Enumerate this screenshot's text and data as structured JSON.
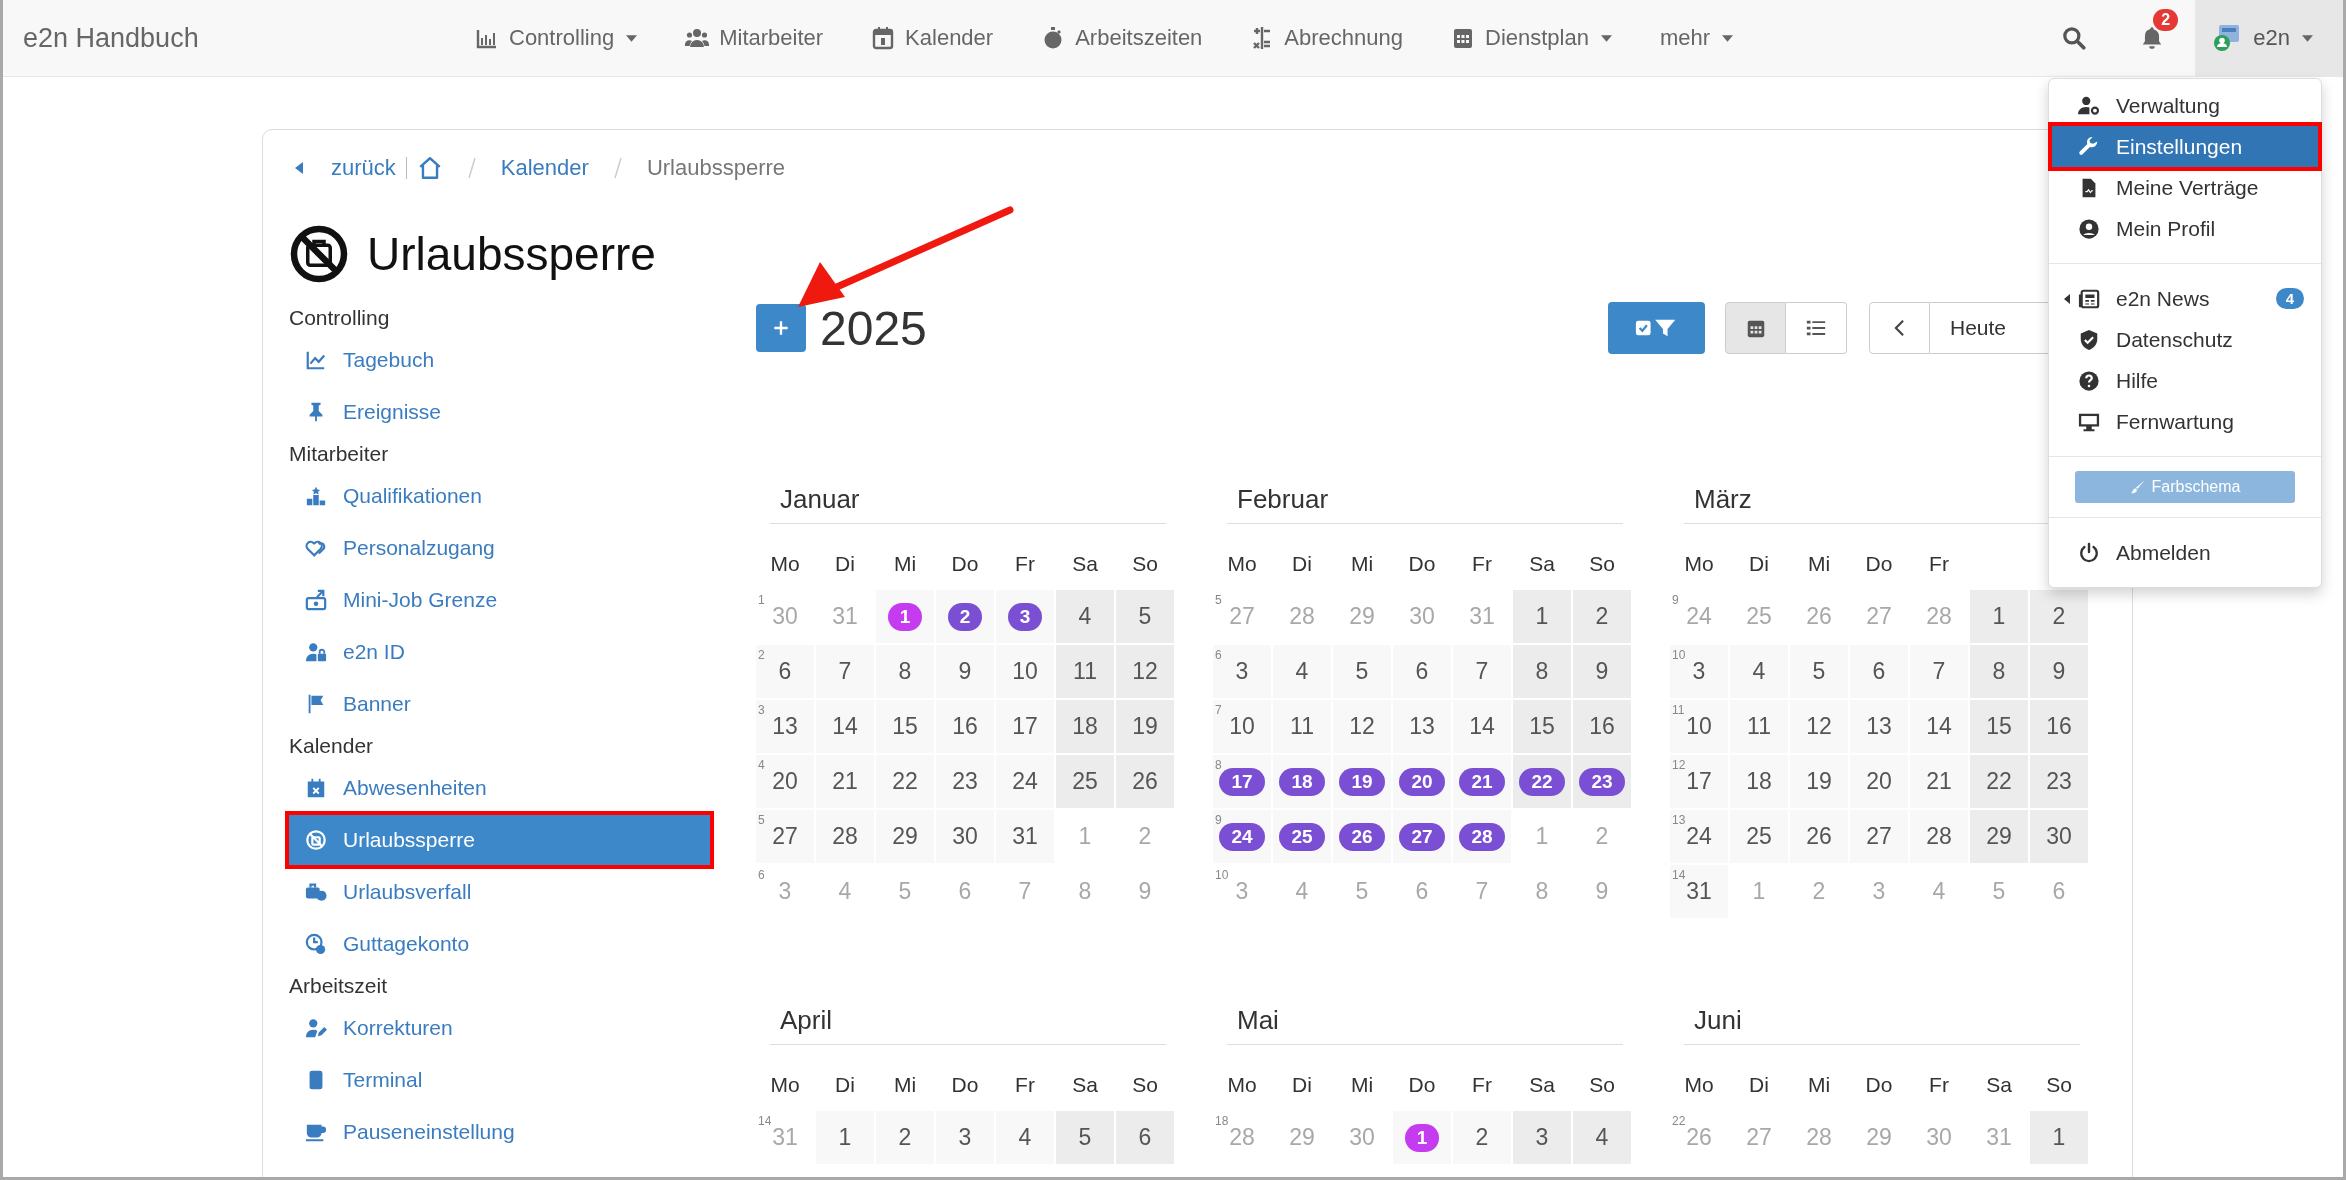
{
  "app_title": "e2n Handbuch",
  "nav": [
    {
      "label": "Controlling",
      "has_menu": true
    },
    {
      "label": "Mitarbeiter",
      "has_menu": false
    },
    {
      "label": "Kalender",
      "has_menu": false
    },
    {
      "label": "Arbeitszeiten",
      "has_menu": false
    },
    {
      "label": "Abrechnung",
      "has_menu": false
    },
    {
      "label": "Dienstplan",
      "has_menu": true
    },
    {
      "label": "mehr",
      "has_menu": true
    }
  ],
  "notifications": {
    "count": "2"
  },
  "user": {
    "name": "e2n",
    "menu_open": true
  },
  "breadcrumb": {
    "back": "zurück",
    "items": [
      {
        "label": "Kalender",
        "link": true
      },
      {
        "label": "Urlaubssperre",
        "link": false
      }
    ]
  },
  "page_title": "Urlaubssperre",
  "sidebar": [
    {
      "heading": "Controlling",
      "items": [
        {
          "label": "Tagebuch",
          "selected": false,
          "highlighted": false
        },
        {
          "label": "Ereignisse",
          "selected": false,
          "highlighted": false
        }
      ]
    },
    {
      "heading": "Mitarbeiter",
      "items": [
        {
          "label": "Qualifikationen",
          "selected": false,
          "highlighted": false
        },
        {
          "label": "Personalzugang",
          "selected": false,
          "highlighted": false
        },
        {
          "label": "Mini-Job Grenze",
          "selected": false,
          "highlighted": false
        },
        {
          "label": "e2n ID",
          "selected": false,
          "highlighted": false
        },
        {
          "label": "Banner",
          "selected": false,
          "highlighted": false
        }
      ]
    },
    {
      "heading": "Kalender",
      "items": [
        {
          "label": "Abwesenheiten",
          "selected": false,
          "highlighted": false
        },
        {
          "label": "Urlaubssperre",
          "selected": true,
          "highlighted": true
        },
        {
          "label": "Urlaubsverfall",
          "selected": false,
          "highlighted": false
        },
        {
          "label": "Guttagekonto",
          "selected": false,
          "highlighted": false
        }
      ]
    },
    {
      "heading": "Arbeitszeit",
      "items": [
        {
          "label": "Korrekturen",
          "selected": false,
          "highlighted": false
        },
        {
          "label": "Terminal",
          "selected": false,
          "highlighted": false
        },
        {
          "label": "Pauseneinstellung",
          "selected": false,
          "highlighted": false
        }
      ]
    }
  ],
  "year": "2025",
  "arrow_to_add_button": true,
  "views": [
    {
      "selected": true
    },
    {
      "selected": false
    }
  ],
  "today": "Heute",
  "months": [
    {
      "name": "Januar",
      "weekdays": [
        "Mo",
        "Di",
        "Mi",
        "Do",
        "Fr",
        "Sa",
        "So"
      ],
      "weeks": [
        {
          "week": "1",
          "days": [
            {
              "day": "30",
              "in_month": false
            },
            {
              "day": "31",
              "in_month": false
            },
            {
              "day": "1",
              "in_month": true,
              "color": "#c43bf0"
            },
            {
              "day": "2",
              "in_month": true,
              "color": "#7b4fd4"
            },
            {
              "day": "3",
              "in_month": true,
              "color": "#7b4fd4"
            },
            {
              "day": "4",
              "in_month": true
            },
            {
              "day": "5",
              "in_month": true
            }
          ]
        },
        {
          "week": "2",
          "days": [
            {
              "day": "6",
              "in_month": true
            },
            {
              "day": "7",
              "in_month": true
            },
            {
              "day": "8",
              "in_month": true
            },
            {
              "day": "9",
              "in_month": true
            },
            {
              "day": "10",
              "in_month": true
            },
            {
              "day": "11",
              "in_month": true
            },
            {
              "day": "12",
              "in_month": true
            }
          ]
        },
        {
          "week": "3",
          "days": [
            {
              "day": "13",
              "in_month": true
            },
            {
              "day": "14",
              "in_month": true
            },
            {
              "day": "15",
              "in_month": true
            },
            {
              "day": "16",
              "in_month": true
            },
            {
              "day": "17",
              "in_month": true
            },
            {
              "day": "18",
              "in_month": true
            },
            {
              "day": "19",
              "in_month": true
            }
          ]
        },
        {
          "week": "4",
          "days": [
            {
              "day": "20",
              "in_month": true
            },
            {
              "day": "21",
              "in_month": true
            },
            {
              "day": "22",
              "in_month": true
            },
            {
              "day": "23",
              "in_month": true
            },
            {
              "day": "24",
              "in_month": true
            },
            {
              "day": "25",
              "in_month": true
            },
            {
              "day": "26",
              "in_month": true
            }
          ]
        },
        {
          "week": "5",
          "days": [
            {
              "day": "27",
              "in_month": true
            },
            {
              "day": "28",
              "in_month": true
            },
            {
              "day": "29",
              "in_month": true
            },
            {
              "day": "30",
              "in_month": true
            },
            {
              "day": "31",
              "in_month": true
            },
            {
              "day": "1",
              "in_month": false
            },
            {
              "day": "2",
              "in_month": false
            }
          ]
        },
        {
          "week": "6",
          "days": [
            {
              "day": "3",
              "in_month": false
            },
            {
              "day": "4",
              "in_month": false
            },
            {
              "day": "5",
              "in_month": false
            },
            {
              "day": "6",
              "in_month": false
            },
            {
              "day": "7",
              "in_month": false
            },
            {
              "day": "8",
              "in_month": false
            },
            {
              "day": "9",
              "in_month": false
            }
          ]
        }
      ]
    },
    {
      "name": "Februar",
      "weekdays": [
        "Mo",
        "Di",
        "Mi",
        "Do",
        "Fr",
        "Sa",
        "So"
      ],
      "weeks": [
        {
          "week": "5",
          "days": [
            {
              "day": "27",
              "in_month": false
            },
            {
              "day": "28",
              "in_month": false
            },
            {
              "day": "29",
              "in_month": false
            },
            {
              "day": "30",
              "in_month": false
            },
            {
              "day": "31",
              "in_month": false
            },
            {
              "day": "1",
              "in_month": true
            },
            {
              "day": "2",
              "in_month": true
            }
          ]
        },
        {
          "week": "6",
          "days": [
            {
              "day": "3",
              "in_month": true
            },
            {
              "day": "4",
              "in_month": true
            },
            {
              "day": "5",
              "in_month": true
            },
            {
              "day": "6",
              "in_month": true
            },
            {
              "day": "7",
              "in_month": true
            },
            {
              "day": "8",
              "in_month": true
            },
            {
              "day": "9",
              "in_month": true
            }
          ]
        },
        {
          "week": "7",
          "days": [
            {
              "day": "10",
              "in_month": true
            },
            {
              "day": "11",
              "in_month": true
            },
            {
              "day": "12",
              "in_month": true
            },
            {
              "day": "13",
              "in_month": true
            },
            {
              "day": "14",
              "in_month": true
            },
            {
              "day": "15",
              "in_month": true
            },
            {
              "day": "16",
              "in_month": true
            }
          ]
        },
        {
          "week": "8",
          "days": [
            {
              "day": "17",
              "in_month": true,
              "color": "#7b4fd4"
            },
            {
              "day": "18",
              "in_month": true,
              "color": "#7b4fd4"
            },
            {
              "day": "19",
              "in_month": true,
              "color": "#7b4fd4"
            },
            {
              "day": "20",
              "in_month": true,
              "color": "#7b4fd4"
            },
            {
              "day": "21",
              "in_month": true,
              "color": "#7b4fd4"
            },
            {
              "day": "22",
              "in_month": true,
              "color": "#7b4fd4"
            },
            {
              "day": "23",
              "in_month": true,
              "color": "#7b4fd4"
            }
          ]
        },
        {
          "week": "9",
          "days": [
            {
              "day": "24",
              "in_month": true,
              "color": "#7b4fd4"
            },
            {
              "day": "25",
              "in_month": true,
              "color": "#7b4fd4"
            },
            {
              "day": "26",
              "in_month": true,
              "color": "#7b4fd4"
            },
            {
              "day": "27",
              "in_month": true,
              "color": "#7b4fd4"
            },
            {
              "day": "28",
              "in_month": true,
              "color": "#7b4fd4"
            },
            {
              "day": "1",
              "in_month": false
            },
            {
              "day": "2",
              "in_month": false
            }
          ]
        },
        {
          "week": "10",
          "days": [
            {
              "day": "3",
              "in_month": false
            },
            {
              "day": "4",
              "in_month": false
            },
            {
              "day": "5",
              "in_month": false
            },
            {
              "day": "6",
              "in_month": false
            },
            {
              "day": "7",
              "in_month": false
            },
            {
              "day": "8",
              "in_month": false
            },
            {
              "day": "9",
              "in_month": false
            }
          ]
        }
      ]
    },
    {
      "name": "März",
      "weekdays": [
        "Mo",
        "Di",
        "Mi",
        "Do",
        "Fr"
      ],
      "weeks": [
        {
          "week": "9",
          "days": [
            {
              "day": "24",
              "in_month": false
            },
            {
              "day": "25",
              "in_month": false
            },
            {
              "day": "26",
              "in_month": false
            },
            {
              "day": "27",
              "in_month": false
            },
            {
              "day": "28",
              "in_month": false
            },
            {
              "day": "1",
              "in_month": true
            },
            {
              "day": "2",
              "in_month": true
            }
          ]
        },
        {
          "week": "10",
          "days": [
            {
              "day": "3",
              "in_month": true
            },
            {
              "day": "4",
              "in_month": true
            },
            {
              "day": "5",
              "in_month": true
            },
            {
              "day": "6",
              "in_month": true
            },
            {
              "day": "7",
              "in_month": true
            },
            {
              "day": "8",
              "in_month": true
            },
            {
              "day": "9",
              "in_month": true
            }
          ]
        },
        {
          "week": "11",
          "days": [
            {
              "day": "10",
              "in_month": true
            },
            {
              "day": "11",
              "in_month": true
            },
            {
              "day": "12",
              "in_month": true
            },
            {
              "day": "13",
              "in_month": true
            },
            {
              "day": "14",
              "in_month": true
            },
            {
              "day": "15",
              "in_month": true
            },
            {
              "day": "16",
              "in_month": true
            }
          ]
        },
        {
          "week": "12",
          "days": [
            {
              "day": "17",
              "in_month": true
            },
            {
              "day": "18",
              "in_month": true
            },
            {
              "day": "19",
              "in_month": true
            },
            {
              "day": "20",
              "in_month": true
            },
            {
              "day": "21",
              "in_month": true
            },
            {
              "day": "22",
              "in_month": true
            },
            {
              "day": "23",
              "in_month": true
            }
          ]
        },
        {
          "week": "13",
          "days": [
            {
              "day": "24",
              "in_month": true
            },
            {
              "day": "25",
              "in_month": true
            },
            {
              "day": "26",
              "in_month": true
            },
            {
              "day": "27",
              "in_month": true
            },
            {
              "day": "28",
              "in_month": true
            },
            {
              "day": "29",
              "in_month": true
            },
            {
              "day": "30",
              "in_month": true
            }
          ]
        },
        {
          "week": "14",
          "days": [
            {
              "day": "31",
              "in_month": true
            },
            {
              "day": "1",
              "in_month": false
            },
            {
              "day": "2",
              "in_month": false
            },
            {
              "day": "3",
              "in_month": false
            },
            {
              "day": "4",
              "in_month": false
            },
            {
              "day": "5",
              "in_month": false
            },
            {
              "day": "6",
              "in_month": false
            }
          ]
        }
      ]
    },
    {
      "name": "April",
      "weekdays": [
        "Mo",
        "Di",
        "Mi",
        "Do",
        "Fr",
        "Sa",
        "So"
      ],
      "weeks": [
        {
          "week": "14",
          "days": [
            {
              "day": "31",
              "in_month": false
            },
            {
              "day": "1",
              "in_month": true
            },
            {
              "day": "2",
              "in_month": true
            },
            {
              "day": "3",
              "in_month": true
            },
            {
              "day": "4",
              "in_month": true
            },
            {
              "day": "5",
              "in_month": true
            },
            {
              "day": "6",
              "in_month": true
            }
          ]
        }
      ]
    },
    {
      "name": "Mai",
      "weekdays": [
        "Mo",
        "Di",
        "Mi",
        "Do",
        "Fr",
        "Sa",
        "So"
      ],
      "weeks": [
        {
          "week": "18",
          "days": [
            {
              "day": "28",
              "in_month": false
            },
            {
              "day": "29",
              "in_month": false
            },
            {
              "day": "30",
              "in_month": false
            },
            {
              "day": "1",
              "in_month": true,
              "color": "#c43bf0"
            },
            {
              "day": "2",
              "in_month": true
            },
            {
              "day": "3",
              "in_month": true
            },
            {
              "day": "4",
              "in_month": true
            }
          ]
        }
      ]
    },
    {
      "name": "Juni",
      "weekdays": [
        "Mo",
        "Di",
        "Mi",
        "Do",
        "Fr",
        "Sa",
        "So"
      ],
      "weeks": [
        {
          "week": "22",
          "days": [
            {
              "day": "26",
              "in_month": false
            },
            {
              "day": "27",
              "in_month": false
            },
            {
              "day": "28",
              "in_month": false
            },
            {
              "day": "29",
              "in_month": false
            },
            {
              "day": "30",
              "in_month": false
            },
            {
              "day": "31",
              "in_month": false
            },
            {
              "day": "1",
              "in_month": true
            }
          ]
        }
      ]
    }
  ],
  "user_menu": {
    "sections": [
      [
        {
          "label": "Verwaltung",
          "selected": false,
          "highlighted": false
        },
        {
          "label": "Einstellungen",
          "selected": true,
          "highlighted": true
        },
        {
          "label": "Meine Verträge",
          "selected": false,
          "highlighted": false
        },
        {
          "label": "Mein Profil",
          "selected": false,
          "highlighted": false
        }
      ],
      [
        {
          "label": "e2n News",
          "selected": false,
          "highlighted": false,
          "submenu": true,
          "badge": "4"
        },
        {
          "label": "Datenschutz",
          "selected": false,
          "highlighted": false
        },
        {
          "label": "Hilfe",
          "selected": false,
          "highlighted": false
        },
        {
          "label": "Fernwartung",
          "selected": false,
          "highlighted": false
        }
      ]
    ],
    "color_scheme": "Farbschema",
    "logout": "Abmelden"
  }
}
